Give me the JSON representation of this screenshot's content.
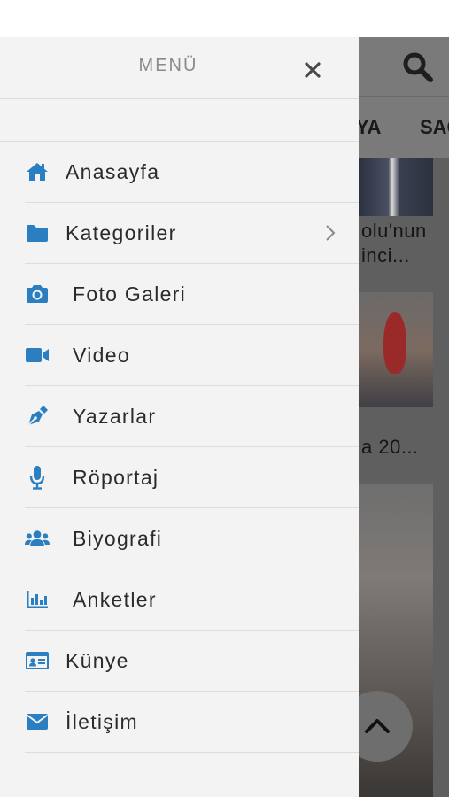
{
  "background": {
    "tabs": [
      "NYA",
      "SAG"
    ],
    "snippets": [
      "olu'nun",
      "inci...",
      "a 20..."
    ]
  },
  "menu": {
    "title": "MENÜ",
    "items": [
      {
        "label": "Anasayfa",
        "icon": "home-icon"
      },
      {
        "label": "Kategoriler",
        "icon": "folder-icon",
        "has_submenu": true
      },
      {
        "label": "Foto Galeri",
        "icon": "camera-icon"
      },
      {
        "label": "Video",
        "icon": "video-camera-icon"
      },
      {
        "label": "Yazarlar",
        "icon": "pen-icon"
      },
      {
        "label": "Röportaj",
        "icon": "microphone-icon"
      },
      {
        "label": "Biyografi",
        "icon": "users-icon"
      },
      {
        "label": "Anketler",
        "icon": "bar-chart-icon"
      },
      {
        "label": "Künye",
        "icon": "id-card-icon"
      },
      {
        "label": "İletişim",
        "icon": "envelope-icon"
      }
    ]
  },
  "colors": {
    "accent": "#2b7fc1",
    "drawer_bg": "#f3f3f3",
    "text": "#2b2b2b"
  }
}
